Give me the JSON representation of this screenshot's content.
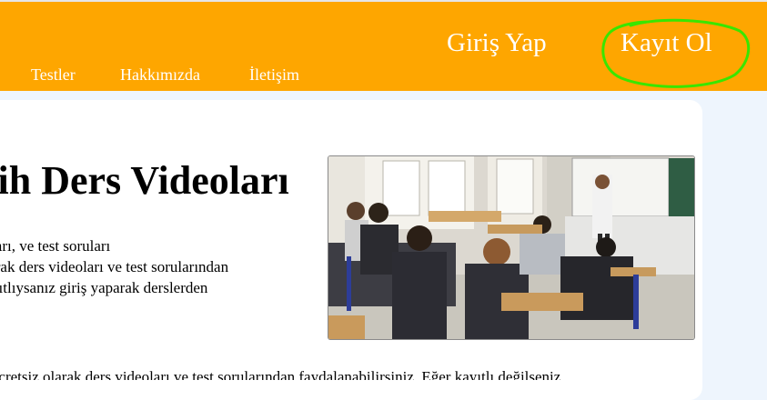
{
  "header": {
    "login_label": "Giriş Yap",
    "register_label": "Kayıt Ol",
    "background_color": "#fea600",
    "highlight_color": "#39e600"
  },
  "nav": {
    "items": [
      {
        "label": "Testler"
      },
      {
        "label": "Hakkımızda"
      },
      {
        "label": "İletişim"
      }
    ]
  },
  "main": {
    "heading": "rih Ders Videoları",
    "paragraph_lines": [
      "eoları, ve test soruları",
      " olarak ders videoları ve test sorularından",
      "kayıtlıysanız giriş yaparak derslerden"
    ],
    "bottom_line": "r ücretsiz olarak ders videoları ve test sorularından faydalanabilirsiniz. Eğer kayıtlı değilseniz"
  },
  "image": {
    "icon_name": "classroom-photo"
  }
}
